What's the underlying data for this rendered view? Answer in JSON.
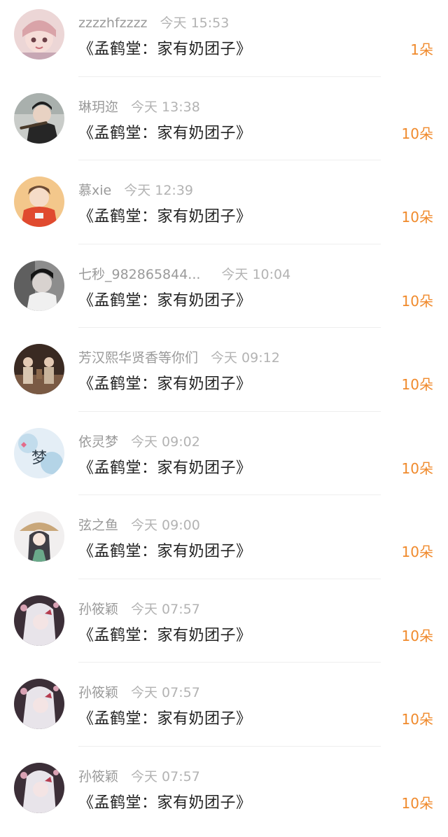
{
  "colors": {
    "name_gray": "#9a9a9a",
    "time_gray": "#b3b3b3",
    "message_black": "#222222",
    "gift_orange": "#f08a2c"
  },
  "entries": [
    {
      "name": "zzzzhfzzzz",
      "time": "今天 15:53",
      "message": "《孟鹤堂：家有奶团子》",
      "gift": "1朵",
      "avatar": "pink-girl-avatar"
    },
    {
      "name": "琳玥迩",
      "time": "今天 13:38",
      "message": "《孟鹤堂：家有奶团子》",
      "gift": "10朵",
      "avatar": "flute-man-avatar"
    },
    {
      "name": "慕xie",
      "time": "今天 12:39",
      "message": "《孟鹤堂：家有奶团子》",
      "gift": "10朵",
      "avatar": "red-jacket-boy-avatar"
    },
    {
      "name": "七秒_982865844...",
      "time": "今天 10:04",
      "message": "《孟鹤堂：家有奶团子》",
      "gift": "10朵",
      "avatar": "dark-hair-man-avatar"
    },
    {
      "name": "芳汉熙华贤香等你们",
      "time": "今天 09:12",
      "message": "《孟鹤堂：家有奶团子》",
      "gift": "10朵",
      "avatar": "stage-performers-avatar"
    },
    {
      "name": "依灵梦",
      "time": "今天 09:02",
      "message": "《孟鹤堂：家有奶团子》",
      "gift": "10朵",
      "avatar": "meng-character-avatar"
    },
    {
      "name": "弦之鱼",
      "time": "今天 09:00",
      "message": "《孟鹤堂：家有奶团子》",
      "gift": "10朵",
      "avatar": "hat-girl-avatar"
    },
    {
      "name": "孙筱颖",
      "time": "今天 07:57",
      "message": "《孟鹤堂：家有奶团子》",
      "gift": "10朵",
      "avatar": "white-hair-girl-avatar"
    },
    {
      "name": "孙筱颖",
      "time": "今天 07:57",
      "message": "《孟鹤堂：家有奶团子》",
      "gift": "10朵",
      "avatar": "white-hair-girl-avatar"
    },
    {
      "name": "孙筱颖",
      "time": "今天 07:57",
      "message": "《孟鹤堂：家有奶团子》",
      "gift": "10朵",
      "avatar": "white-hair-girl-avatar"
    }
  ],
  "avatar_glyph_6": "梦"
}
